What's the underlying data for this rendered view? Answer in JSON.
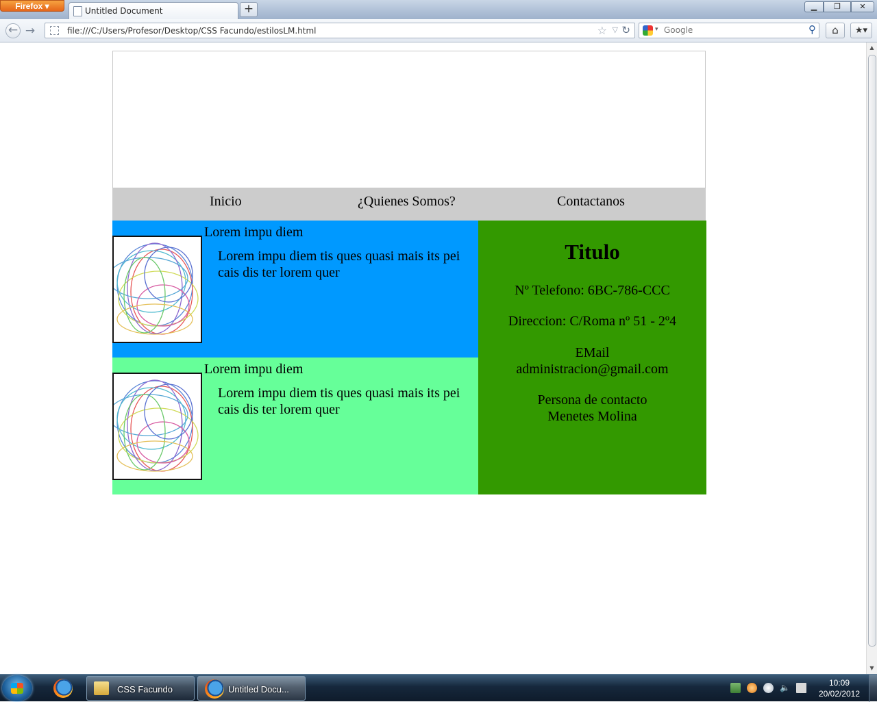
{
  "browser": {
    "menu_button": "Firefox ▾",
    "tab_title": "Untitled Document",
    "new_tab": "+",
    "window_controls": {
      "minimize": "▁",
      "maximize": "❐",
      "close": "✕"
    },
    "url": "file:///C:/Users/Profesor/Desktop/CSS Facundo/estilosLM.html",
    "search_placeholder": "Google",
    "icons": {
      "back": "back-arrow-icon",
      "forward": "forward-arrow-icon",
      "bookmark": "star-icon",
      "reload": "reload-icon",
      "search": "magnifier-icon",
      "home": "home-icon",
      "bookmarks": "bookmarks-icon"
    }
  },
  "page": {
    "nav": [
      "Inicio",
      "¿Quienes Somos?",
      "Contactanos"
    ],
    "articles": [
      {
        "title": "Lorem impu diem",
        "text": "Lorem impu diem tis ques quasi mais its pei cais dis ter lorem quer"
      },
      {
        "title": "Lorem impu diem",
        "text": "Lorem impu diem tis ques quasi mais its pei cais dis ter lorem quer"
      }
    ],
    "sidebar": {
      "title": "Titulo",
      "phone": "Nº Telefono: 6BC-786-CCC",
      "address": "Direccion: C/Roma nº 51 - 2º4",
      "email_label": "EMail",
      "email": "administracion@gmail.com",
      "contact_label": "Persona de contacto",
      "contact_name": "Menetes Molina"
    },
    "colors": {
      "nav_bg": "#cccccc",
      "article_1_bg": "#0099ff",
      "article_2_bg": "#66ff99",
      "sidebar_bg": "#339900"
    }
  },
  "taskbar": {
    "items": [
      {
        "label": "CSS Facundo",
        "icon": "folder-icon"
      },
      {
        "label": "Untitled Docu...",
        "icon": "firefox-icon"
      }
    ],
    "clock_time": "10:09",
    "clock_date": "20/02/2012"
  }
}
